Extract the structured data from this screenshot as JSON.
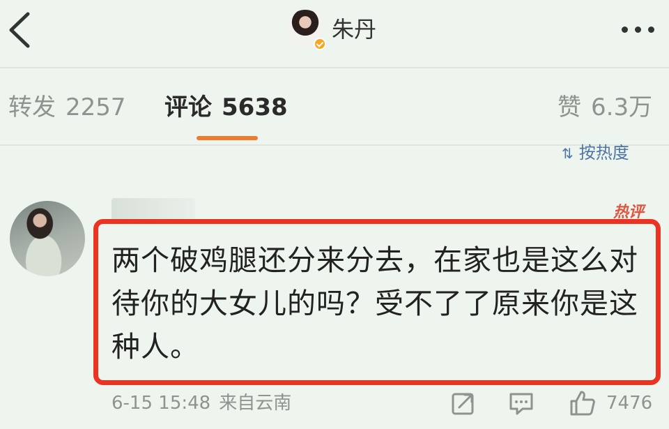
{
  "header": {
    "back_icon": "chevron-left-icon",
    "user_name": "朱丹",
    "verified_icon": "verified-badge-icon",
    "more_icon": "more-dots-icon"
  },
  "tabs": [
    {
      "label": "转发",
      "count": "2257",
      "active": false
    },
    {
      "label": "评论",
      "count": "5638",
      "active": true
    },
    {
      "label": "赞",
      "count": "6.3万",
      "active": false
    }
  ],
  "sort": {
    "icon": "sort-icon",
    "label": "按热度"
  },
  "comment": {
    "hot_badge": "热评",
    "text": "两个破鸡腿还分来分去，在家也是这么对待你的大女儿的吗？受不了了原来你是这种人。",
    "timestamp": "6-15 15:48",
    "location": "来自云南",
    "like_count": "7476"
  },
  "colors": {
    "background": "#eef5ef",
    "accent_orange": "#f07a2f",
    "highlight_red": "#ea3323",
    "link_blue": "#4f74a8",
    "muted_gray": "#8d938e"
  }
}
